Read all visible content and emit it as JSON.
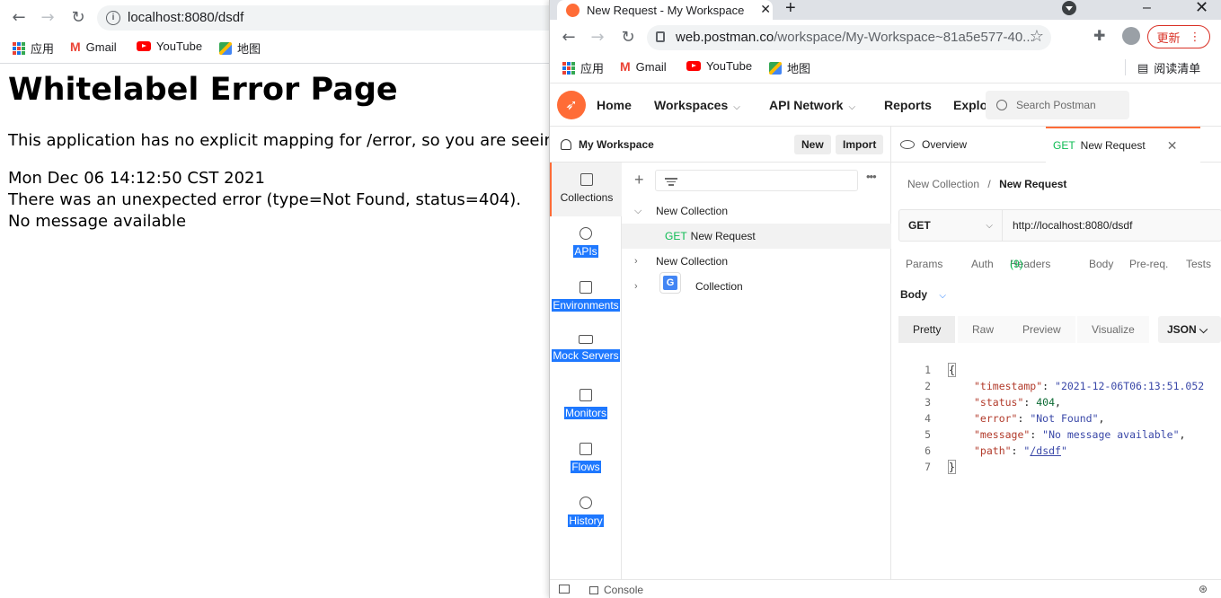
{
  "back_browser": {
    "url": "localhost:8080/dsdf",
    "bookmarks": [
      "应用",
      "Gmail",
      "YouTube",
      "地图"
    ],
    "error_page": {
      "title": "Whitelabel Error Page",
      "line1": "This application has no explicit mapping for /error, so you are seeing th",
      "line2": "Mon Dec 06 14:12:50 CST 2021",
      "line3": "There was an unexpected error (type=Not Found, status=404).",
      "line4": "No message available"
    }
  },
  "postman_browser": {
    "tab_title": "New Request - My Workspace",
    "url_host": "web.postman.co",
    "url_path": "/workspace/My-Workspace~81a5e577-40...",
    "update_label": "更新",
    "bookmarks": [
      "应用",
      "Gmail",
      "YouTube",
      "地图"
    ],
    "reading_list": "阅读清单"
  },
  "postman": {
    "nav": [
      "Home",
      "Workspaces",
      "API Network",
      "Reports",
      "Explo"
    ],
    "search_placeholder": "Search Postman",
    "workspace_name": "My Workspace",
    "new_label": "New",
    "import_label": "Import",
    "sidebar": [
      "Collections",
      "APIs",
      "Environments",
      "Mock Servers",
      "Monitors",
      "Flows",
      "History"
    ],
    "collections": [
      {
        "label": "New Collection",
        "expanded": true
      },
      {
        "method": "GET",
        "label": "New Request"
      },
      {
        "label": "New Collection",
        "expanded": false
      },
      {
        "label": "Collection",
        "expanded": false
      }
    ],
    "tabs": {
      "overview": "Overview",
      "request_method": "GET",
      "request_name": "New Request"
    },
    "breadcrumb": {
      "collection": "New Collection",
      "separator": "/",
      "request": "New Request"
    },
    "request": {
      "method": "GET",
      "url": "http://localhost:8080/dsdf"
    },
    "request_tabs": [
      "Params",
      "Auth",
      "Headers",
      "(9)",
      "Body",
      "Pre-req.",
      "Tests"
    ],
    "response_body_label": "Body",
    "view_tabs": [
      "Pretty",
      "Raw",
      "Preview",
      "Visualize"
    ],
    "format": "JSON",
    "code": {
      "ln": [
        "1",
        "2",
        "3",
        "4",
        "5",
        "6",
        "7"
      ],
      "open": "{",
      "close": "}",
      "timestamp_key": "\"timestamp\"",
      "timestamp_val": "\"2021-12-06T06:13:51.052",
      "status_key": "\"status\"",
      "status_val": "404",
      "error_key": "\"error\"",
      "error_val": "\"Not Found\"",
      "message_key": "\"message\"",
      "message_val": "\"No message available\"",
      "path_key": "\"path\"",
      "path_q1": "\"",
      "path_val": "/dsdf",
      "path_q2": "\""
    },
    "console_label": "Console"
  }
}
